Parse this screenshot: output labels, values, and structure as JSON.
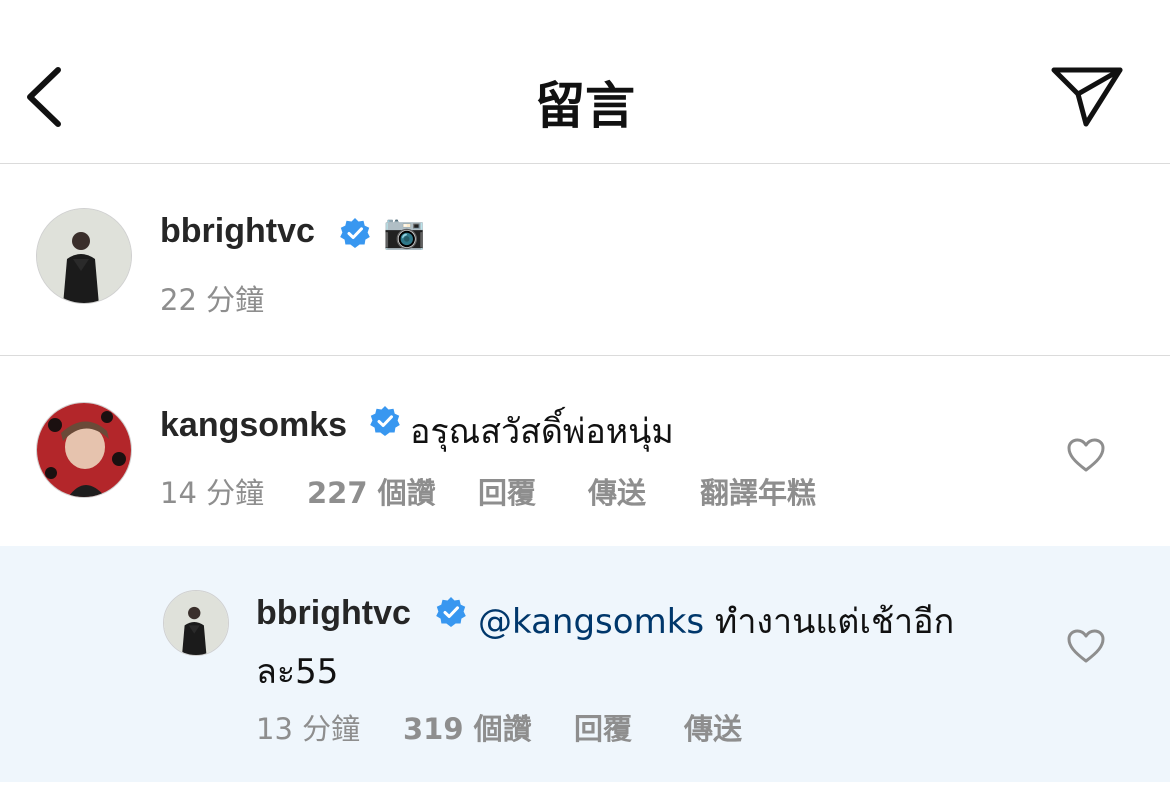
{
  "header": {
    "title": "留言",
    "back_icon": "chevron-left-icon",
    "send_icon": "paper-plane-icon"
  },
  "caption": {
    "username": "bbrightvc",
    "emoji": "📷",
    "time": "22 分鐘"
  },
  "comment": {
    "username": "kangsomks",
    "text": "อรุณสวัสดิ์พ่อหนุ่ม",
    "time": "14 分鐘",
    "likes": "227 個讚",
    "reply_label": "回覆",
    "send_label": "傳送",
    "translate_label": "翻譯年糕"
  },
  "reply": {
    "username": "bbrightvc",
    "mention": "@kangsomks",
    "text_line1": "ทำงานแต่เช้าอีก",
    "text_line2": "ละ55",
    "time": "13 分鐘",
    "likes": "319 個讚",
    "reply_label": "回覆",
    "send_label": "傳送"
  },
  "colors": {
    "verified_badge": "#3897f0",
    "mention": "#00376b",
    "meta_gray": "#8e8e8e",
    "reply_highlight": "#eff6fc"
  }
}
